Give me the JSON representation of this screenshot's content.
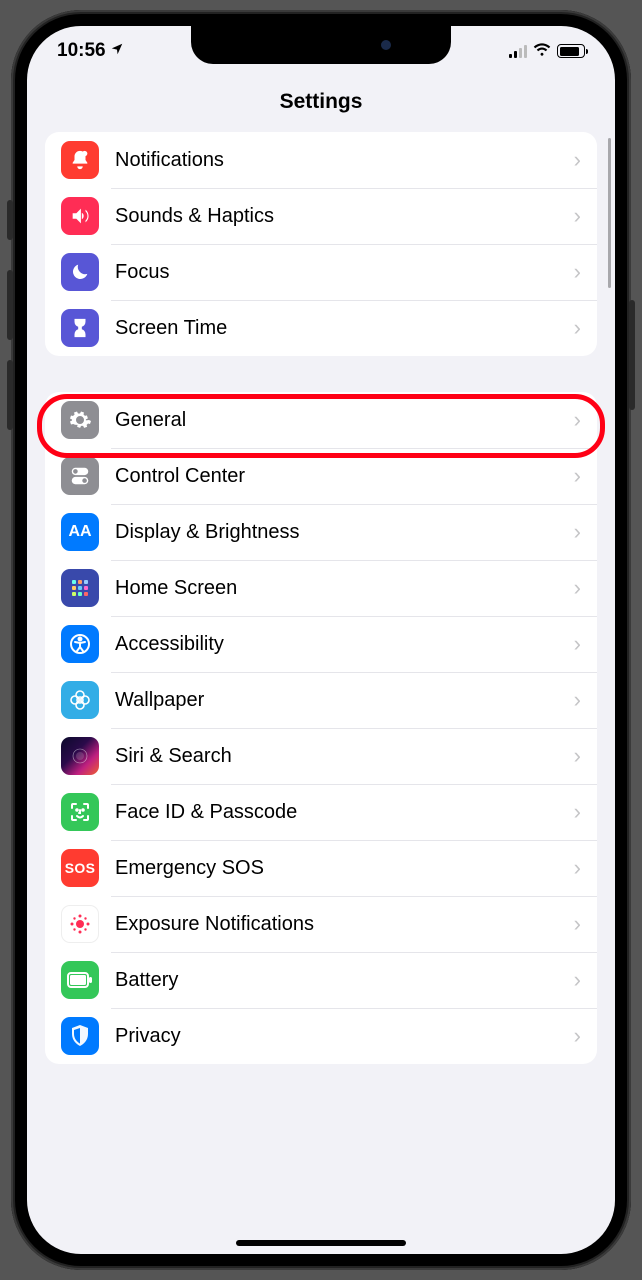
{
  "status": {
    "time": "10:56"
  },
  "title": "Settings",
  "group1": [
    {
      "label": "Notifications"
    },
    {
      "label": "Sounds & Haptics"
    },
    {
      "label": "Focus"
    },
    {
      "label": "Screen Time"
    }
  ],
  "group2": [
    {
      "label": "General"
    },
    {
      "label": "Control Center"
    },
    {
      "label": "Display & Brightness"
    },
    {
      "label": "Home Screen"
    },
    {
      "label": "Accessibility"
    },
    {
      "label": "Wallpaper"
    },
    {
      "label": "Siri & Search"
    },
    {
      "label": "Face ID & Passcode"
    },
    {
      "label": "Emergency SOS"
    },
    {
      "label": "Exposure Notifications"
    },
    {
      "label": "Battery"
    },
    {
      "label": "Privacy"
    }
  ],
  "highlighted": "General"
}
